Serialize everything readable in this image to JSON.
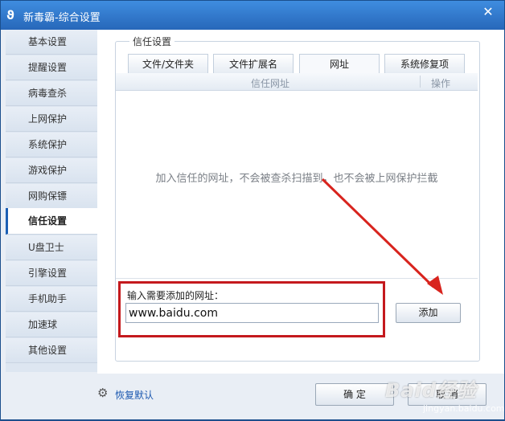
{
  "window": {
    "title": "新毒霸-综合设置",
    "close_glyph": "✕",
    "logo_glyph": "ϑ"
  },
  "sidebar": {
    "items": [
      {
        "label": "基本设置",
        "active": false
      },
      {
        "label": "提醒设置",
        "active": false
      },
      {
        "label": "病毒查杀",
        "active": false
      },
      {
        "label": "上网保护",
        "active": false
      },
      {
        "label": "系统保护",
        "active": false
      },
      {
        "label": "游戏保护",
        "active": false
      },
      {
        "label": "网购保镖",
        "active": false
      },
      {
        "label": "信任设置",
        "active": true
      },
      {
        "label": "U盘卫士",
        "active": false
      },
      {
        "label": "引擎设置",
        "active": false
      },
      {
        "label": "手机助手",
        "active": false
      },
      {
        "label": "加速球",
        "active": false
      },
      {
        "label": "其他设置",
        "active": false
      }
    ]
  },
  "main": {
    "group_title": "信任设置",
    "tabs": [
      {
        "label": "文件/文件夹",
        "active": false
      },
      {
        "label": "文件扩展名",
        "active": false
      },
      {
        "label": "网址",
        "active": true
      },
      {
        "label": "系统修复项",
        "active": false
      }
    ],
    "grid": {
      "col_url": "信任网址",
      "col_action": "操作",
      "empty_hint": "加入信任的网址，不会被查杀扫描到，也不会被上网保护拦截"
    },
    "input": {
      "label": "输入需要添加的网址：",
      "value": "www.baidu.com"
    },
    "add_button": "添加"
  },
  "footer": {
    "restore_label": "恢复默认",
    "ok_label": "确 定",
    "cancel_label": "取 消"
  },
  "watermark": {
    "main": "Baid经验",
    "sub": "jingyan.baidu.com"
  },
  "colors": {
    "title_bar": "#2a6fc3",
    "annotation_red": "#c4191d",
    "link_blue": "#1c58b0"
  }
}
